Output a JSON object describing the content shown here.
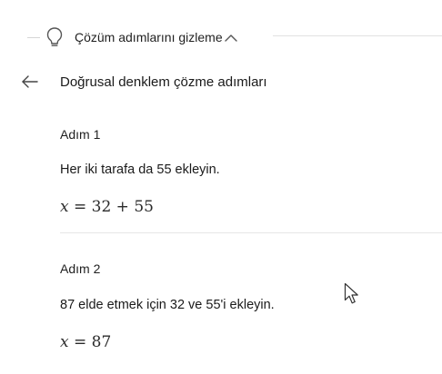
{
  "toggle": {
    "label": "Çözüm adımlarını gizleme",
    "icon": "lightbulb-icon",
    "chevron": "chevron-up-icon"
  },
  "header": {
    "back_icon": "arrow-left-icon",
    "title": "Doğrusal denklem çözme adımları"
  },
  "steps": [
    {
      "label": "Adım 1",
      "description": "Her iki tarafa da 55 ekleyin.",
      "equation": {
        "variable": "x",
        "rest": " = 32 + 55"
      }
    },
    {
      "label": "Adım 2",
      "description": "87 elde etmek için 32 ve 55'i ekleyin.",
      "equation": {
        "variable": "x",
        "rest": " = 87"
      }
    }
  ],
  "colors": {
    "text": "#1a1a1a",
    "divider": "#e6e6e6",
    "icon": "#555555"
  }
}
